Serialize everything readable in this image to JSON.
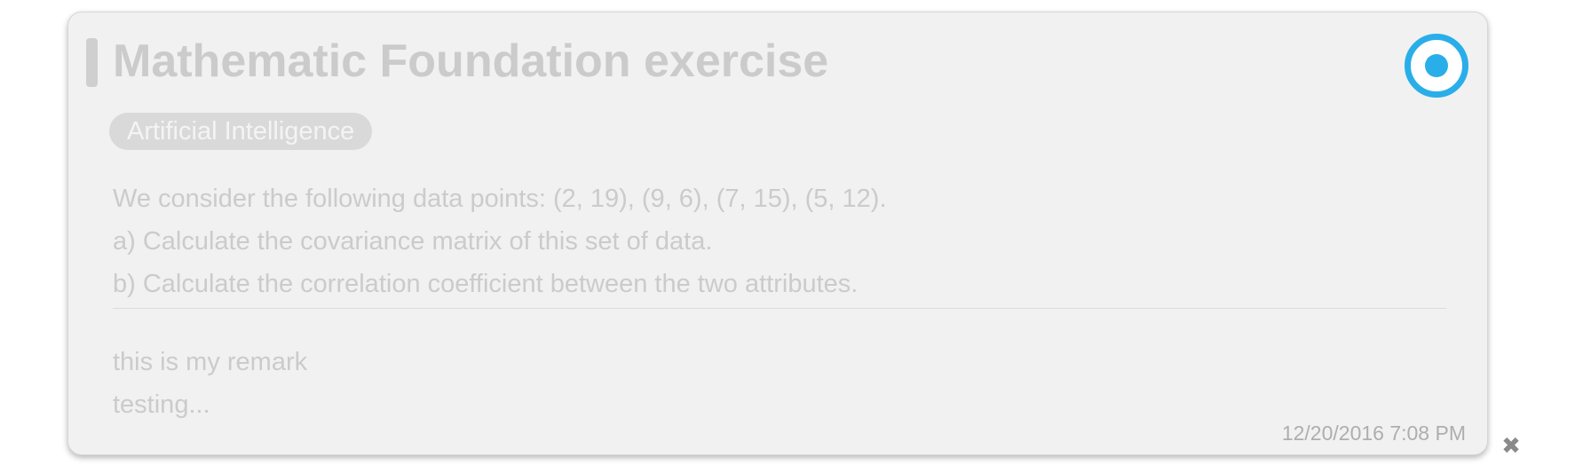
{
  "card": {
    "title": "Mathematic Foundation exercise",
    "tag": "Artificial Intelligence",
    "description_lines": [
      "We consider the following data points: (2, 19), (9, 6), (7, 15), (5, 12).",
      "a) Calculate the covariance matrix of this set of data.",
      "b) Calculate the correlation coefficient between the two attributes."
    ],
    "remark_lines": [
      "this is my remark",
      "testing..."
    ],
    "timestamp": "12/20/2016 7:08 PM",
    "status_icon": "radio-selected-icon",
    "close_icon": "close-icon",
    "close_glyph": "✖"
  },
  "colors": {
    "accent": "#29aee9",
    "card_background": "#f1f1f1",
    "muted_text": "#cbcbcb",
    "tag_background": "#d9d9d9"
  }
}
